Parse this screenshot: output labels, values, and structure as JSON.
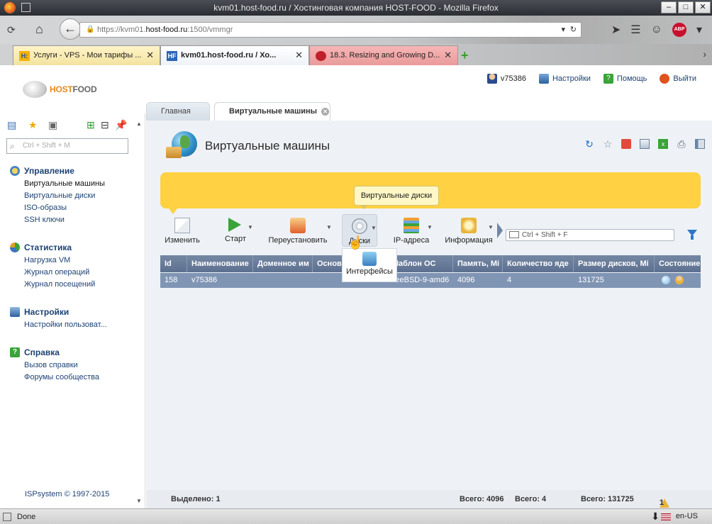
{
  "window": {
    "title": "kvm01.host-food.ru / Хостинговая компания HOST-FOOD - Mozilla Firefox",
    "minimize": "–",
    "maximize": "□",
    "close": "✕"
  },
  "browser": {
    "url_prefix": "https://kvm01.",
    "url_host": "host-food.ru",
    "url_suffix": ":1500/vmmgr",
    "abp_label": "ABP",
    "tabs": [
      {
        "label": "Услуги - VPS - Мои тарифы ...",
        "favicon": "H:"
      },
      {
        "label": "kvm01.host-food.ru / Хо...",
        "favicon": "HF"
      },
      {
        "label": "18.3. Resizing and Growing D...",
        "favicon": ""
      }
    ],
    "new_tab": "+",
    "status_text": "Done",
    "locale": "en-US"
  },
  "page": {
    "logo_host": "HOST",
    "logo_food": "FOOD",
    "top_links": {
      "user": "v75386",
      "settings": "Настройки",
      "help": "Помощь",
      "logout": "Выйти"
    },
    "tabs": [
      {
        "label": "Главная",
        "active": false
      },
      {
        "label": "Виртуальные машины",
        "active": true
      }
    ],
    "sidebar": {
      "search_placeholder": "Ctrl + Shift + M",
      "sections": [
        {
          "title": "Управление",
          "icon": "management-icon",
          "items": [
            "Виртуальные машины",
            "Виртуальные диски",
            "ISO-образы",
            "SSH ключи"
          ]
        },
        {
          "title": "Статистика",
          "icon": "statistics-icon",
          "items": [
            "Нагрузка VM",
            "Журнал операций",
            "Журнал посещений"
          ]
        },
        {
          "title": "Настройки",
          "icon": "settings-icon",
          "items": [
            "Настройки пользоват..."
          ]
        },
        {
          "title": "Справка",
          "icon": "help-icon",
          "items": [
            "Вызов справки",
            "Форумы сообщества"
          ]
        }
      ],
      "copyright": "ISPsystem © 1997-2015"
    },
    "main": {
      "title": "Виртуальные машины",
      "toolbar": [
        {
          "label": "Изменить",
          "icon": "edit-icon",
          "has_menu": false
        },
        {
          "label": "Старт",
          "icon": "play-icon",
          "has_menu": true
        },
        {
          "label": "Переустановить",
          "icon": "reinstall-icon",
          "has_menu": true
        },
        {
          "label": "Диски",
          "icon": "disks-icon",
          "has_menu": true
        },
        {
          "label": "IP-адреса",
          "icon": "ip-icon",
          "has_menu": true
        },
        {
          "label": "Информация",
          "icon": "info-icon",
          "has_menu": true
        }
      ],
      "search_placeholder": "Ctrl + Shift + F",
      "tooltip": "Виртуальные диски",
      "dropdown_item": "Интерфейсы",
      "columns": [
        "Id",
        "Наименование",
        "Доменное им",
        "Основ",
        "Шаблон ОС",
        "Память, Mi",
        "Количество яде",
        "Размер дисков, Mi",
        "Состояние"
      ],
      "rows": [
        {
          "id": "158",
          "name": "v75386",
          "domain": "",
          "main_ip": "",
          "os": "FreeBSD-9-amd6",
          "memory": "4096",
          "cores": "4",
          "disk": "131725"
        }
      ],
      "status": {
        "selected": "Выделено: 1",
        "total_memory": "Всего: 4096",
        "total_cores": "Всего: 4",
        "total_disk": "Всего: 131725",
        "counts": "1,",
        "warnings": "1"
      }
    }
  },
  "colors": {
    "banner": "#ffd143",
    "grid_header": "#5d7090",
    "grid_row_selected": "#8095b4",
    "link": "#1d4273"
  }
}
